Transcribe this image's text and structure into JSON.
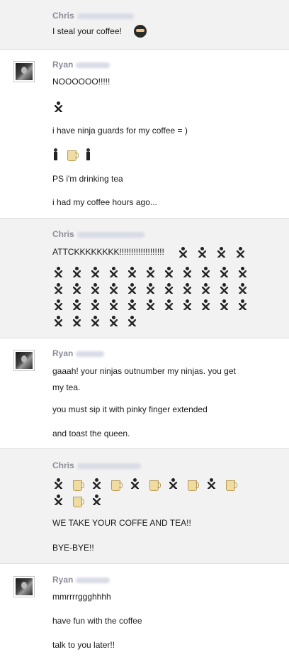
{
  "messages": [
    {
      "sender": "Chris",
      "lines": [
        "I steal your coffee!"
      ]
    },
    {
      "sender": "Ryan",
      "lines": [
        "NOOOOOO!!!!!",
        "i have ninja guards for my coffee = )",
        "PS i'm drinking tea",
        "i had my coffee hours ago..."
      ]
    },
    {
      "sender": "Chris",
      "lines": [
        "ATTCKKKKKKKK!!!!!!!!!!!!!!!!!!!"
      ]
    },
    {
      "sender": "Ryan",
      "lines": [
        "gaaah! your ninjas outnumber my ninjas. you get",
        "my tea.",
        "you must sip it with pinky finger extended",
        "and toast the queen."
      ]
    },
    {
      "sender": "Chris",
      "lines": [
        "WE TAKE YOUR COFFE AND TEA!!",
        "BYE-BYE!!"
      ]
    },
    {
      "sender": "Ryan",
      "lines": [
        "mmrrrrggghhhh",
        "have fun with the coffee",
        "talk to you later!!"
      ]
    }
  ],
  "icons": {
    "masked_face": "ninja-mask-icon",
    "ninja": "running-ninja-icon",
    "coffee": "coffee-cup-icon",
    "guard": "guard-icon"
  },
  "colors": {
    "sender_name": "#8c8c98",
    "gray_bg": "#f2f2f2",
    "divider": "#dcdcdc"
  }
}
